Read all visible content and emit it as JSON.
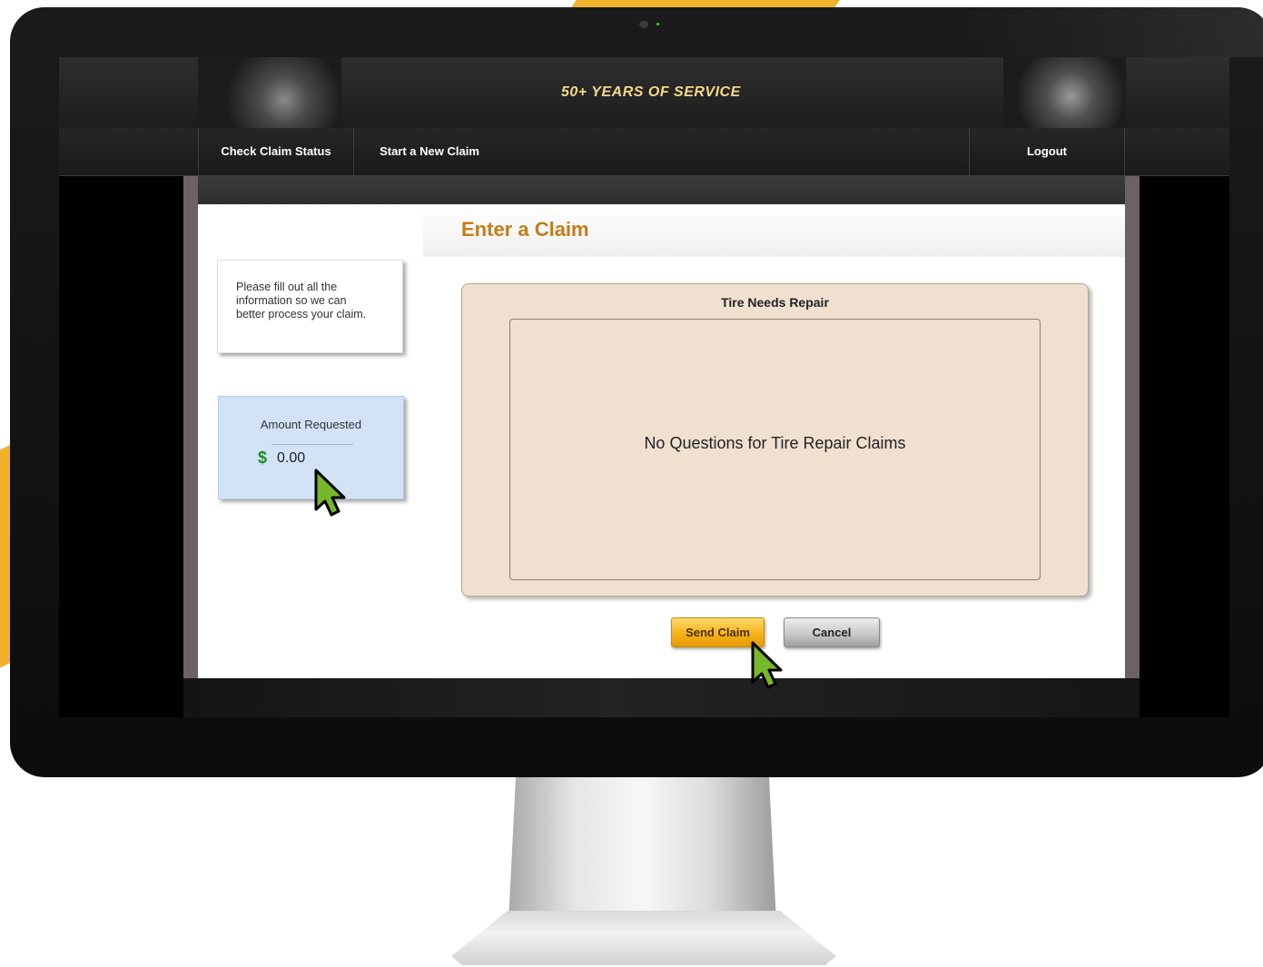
{
  "header": {
    "tagline": "50+ YEARS OF SERVICE"
  },
  "nav": {
    "items": [
      {
        "label": "Check Claim Status"
      },
      {
        "label": "Start a New Claim"
      }
    ],
    "logout_label": "Logout"
  },
  "sidebar": {
    "info_text": "Please fill out all the information so we can better process your claim.",
    "amount_label": "Amount Requested",
    "currency_symbol": "$",
    "amount_value": "0.00"
  },
  "main": {
    "title": "Enter a Claim",
    "panel_title": "Tire Needs Repair",
    "panel_message": "No Questions for Tire Repair Claims",
    "send_label": "Send Claim",
    "cancel_label": "Cancel"
  },
  "colors": {
    "accent": "#f2b12a",
    "title": "#c47c1a",
    "panel": "#f0e0cf",
    "amount_box": "#d2e3f8",
    "cursor": "#76b82a"
  },
  "icons": {
    "cursor": "mouse-pointer-icon"
  }
}
